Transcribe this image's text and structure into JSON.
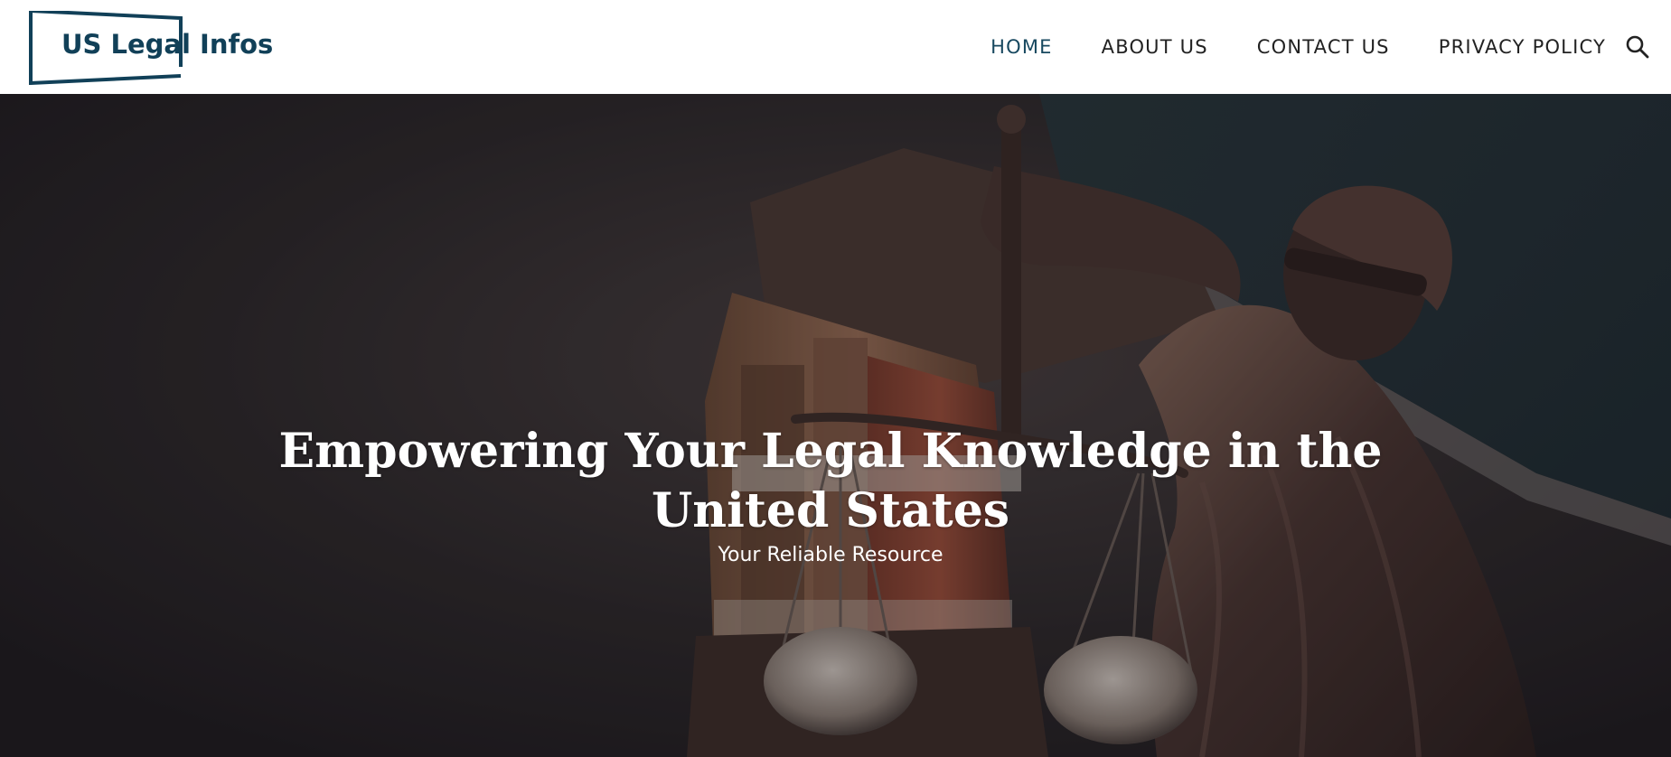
{
  "brand": {
    "logo_text": "US Legal Infos",
    "color": "#114058"
  },
  "nav": {
    "items": [
      {
        "label": "HOME",
        "active": true
      },
      {
        "label": "ABOUT US",
        "active": false
      },
      {
        "label": "CONTACT US",
        "active": false
      },
      {
        "label": "PRIVACY POLICY",
        "active": false
      }
    ],
    "search_icon": "search-icon",
    "active_color": "#17485f"
  },
  "hero": {
    "title_line1": "Empowering Your Legal Knowledge in the",
    "title_line2": "United States",
    "subtitle": "Your Reliable Resource",
    "image": "lady-justice-statue-with-scales-and-law-books"
  }
}
